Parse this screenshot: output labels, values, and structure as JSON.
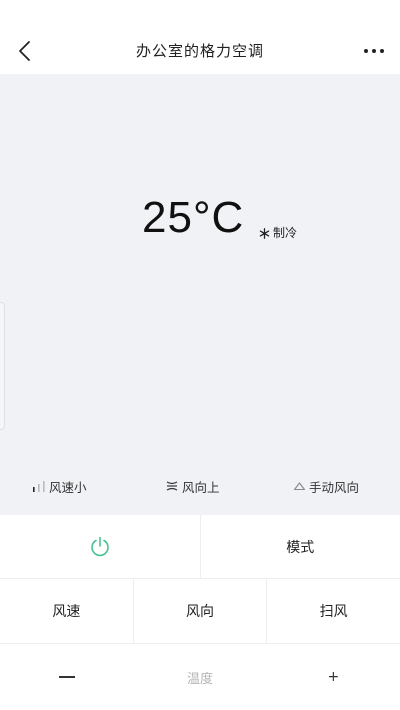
{
  "header": {
    "title": "办公室的格力空调",
    "back_icon": "chevron-left-icon",
    "more_icon": "more-horizontal-icon"
  },
  "display": {
    "temperature": "25°C",
    "mode_icon": "snowflake-icon",
    "mode_label": "制冷",
    "status": [
      {
        "icon": "fan-speed-bars-icon",
        "label": "风速小"
      },
      {
        "icon": "swing-up-icon",
        "label": "风向上"
      },
      {
        "icon": "manual-direction-icon",
        "label": "手动风向"
      }
    ]
  },
  "controls": {
    "power_icon": "power-icon",
    "power_color": "#4cc393",
    "mode_label": "模式",
    "fan_speed_label": "风速",
    "direction_label": "风向",
    "swing_label": "扫风",
    "temperature_label": "温度",
    "increase_label": "+"
  },
  "colors": {
    "panel_bg": "#f1f2f6",
    "accent": "#4cc393"
  }
}
